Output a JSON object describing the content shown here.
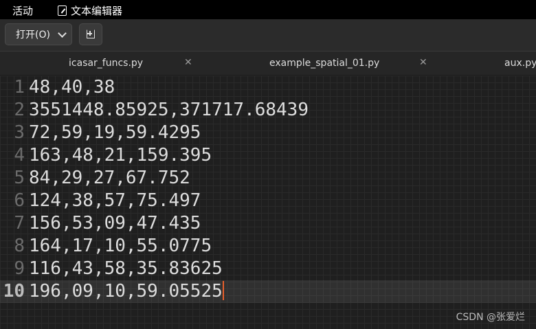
{
  "topbar": {
    "activities": "活动",
    "app_name": "文本编辑器"
  },
  "toolbar": {
    "open_label": "打开(O)"
  },
  "tabs": [
    {
      "label": "icasar_funcs.py"
    },
    {
      "label": "example_spatial_01.py"
    },
    {
      "label": "aux.py"
    }
  ],
  "editor": {
    "lines": [
      {
        "number": "1",
        "text": "48,40,38"
      },
      {
        "number": "2",
        "text": "3551448.85925,371717.68439"
      },
      {
        "number": "3",
        "text": "72,59,19,59.4295"
      },
      {
        "number": "4",
        "text": "163,48,21,159.395"
      },
      {
        "number": "5",
        "text": "84,29,27,67.752"
      },
      {
        "number": "6",
        "text": "124,38,57,75.497"
      },
      {
        "number": "7",
        "text": "156,53,09,47.435"
      },
      {
        "number": "8",
        "text": "164,17,10,55.0775"
      },
      {
        "number": "9",
        "text": "116,43,58,35.83625"
      },
      {
        "number": "10",
        "text": "196,09,10,59.05525"
      }
    ]
  },
  "watermark": "CSDN @张爱烂",
  "colors": {
    "caret": "#e8602c",
    "background": "#1f1f1f"
  }
}
